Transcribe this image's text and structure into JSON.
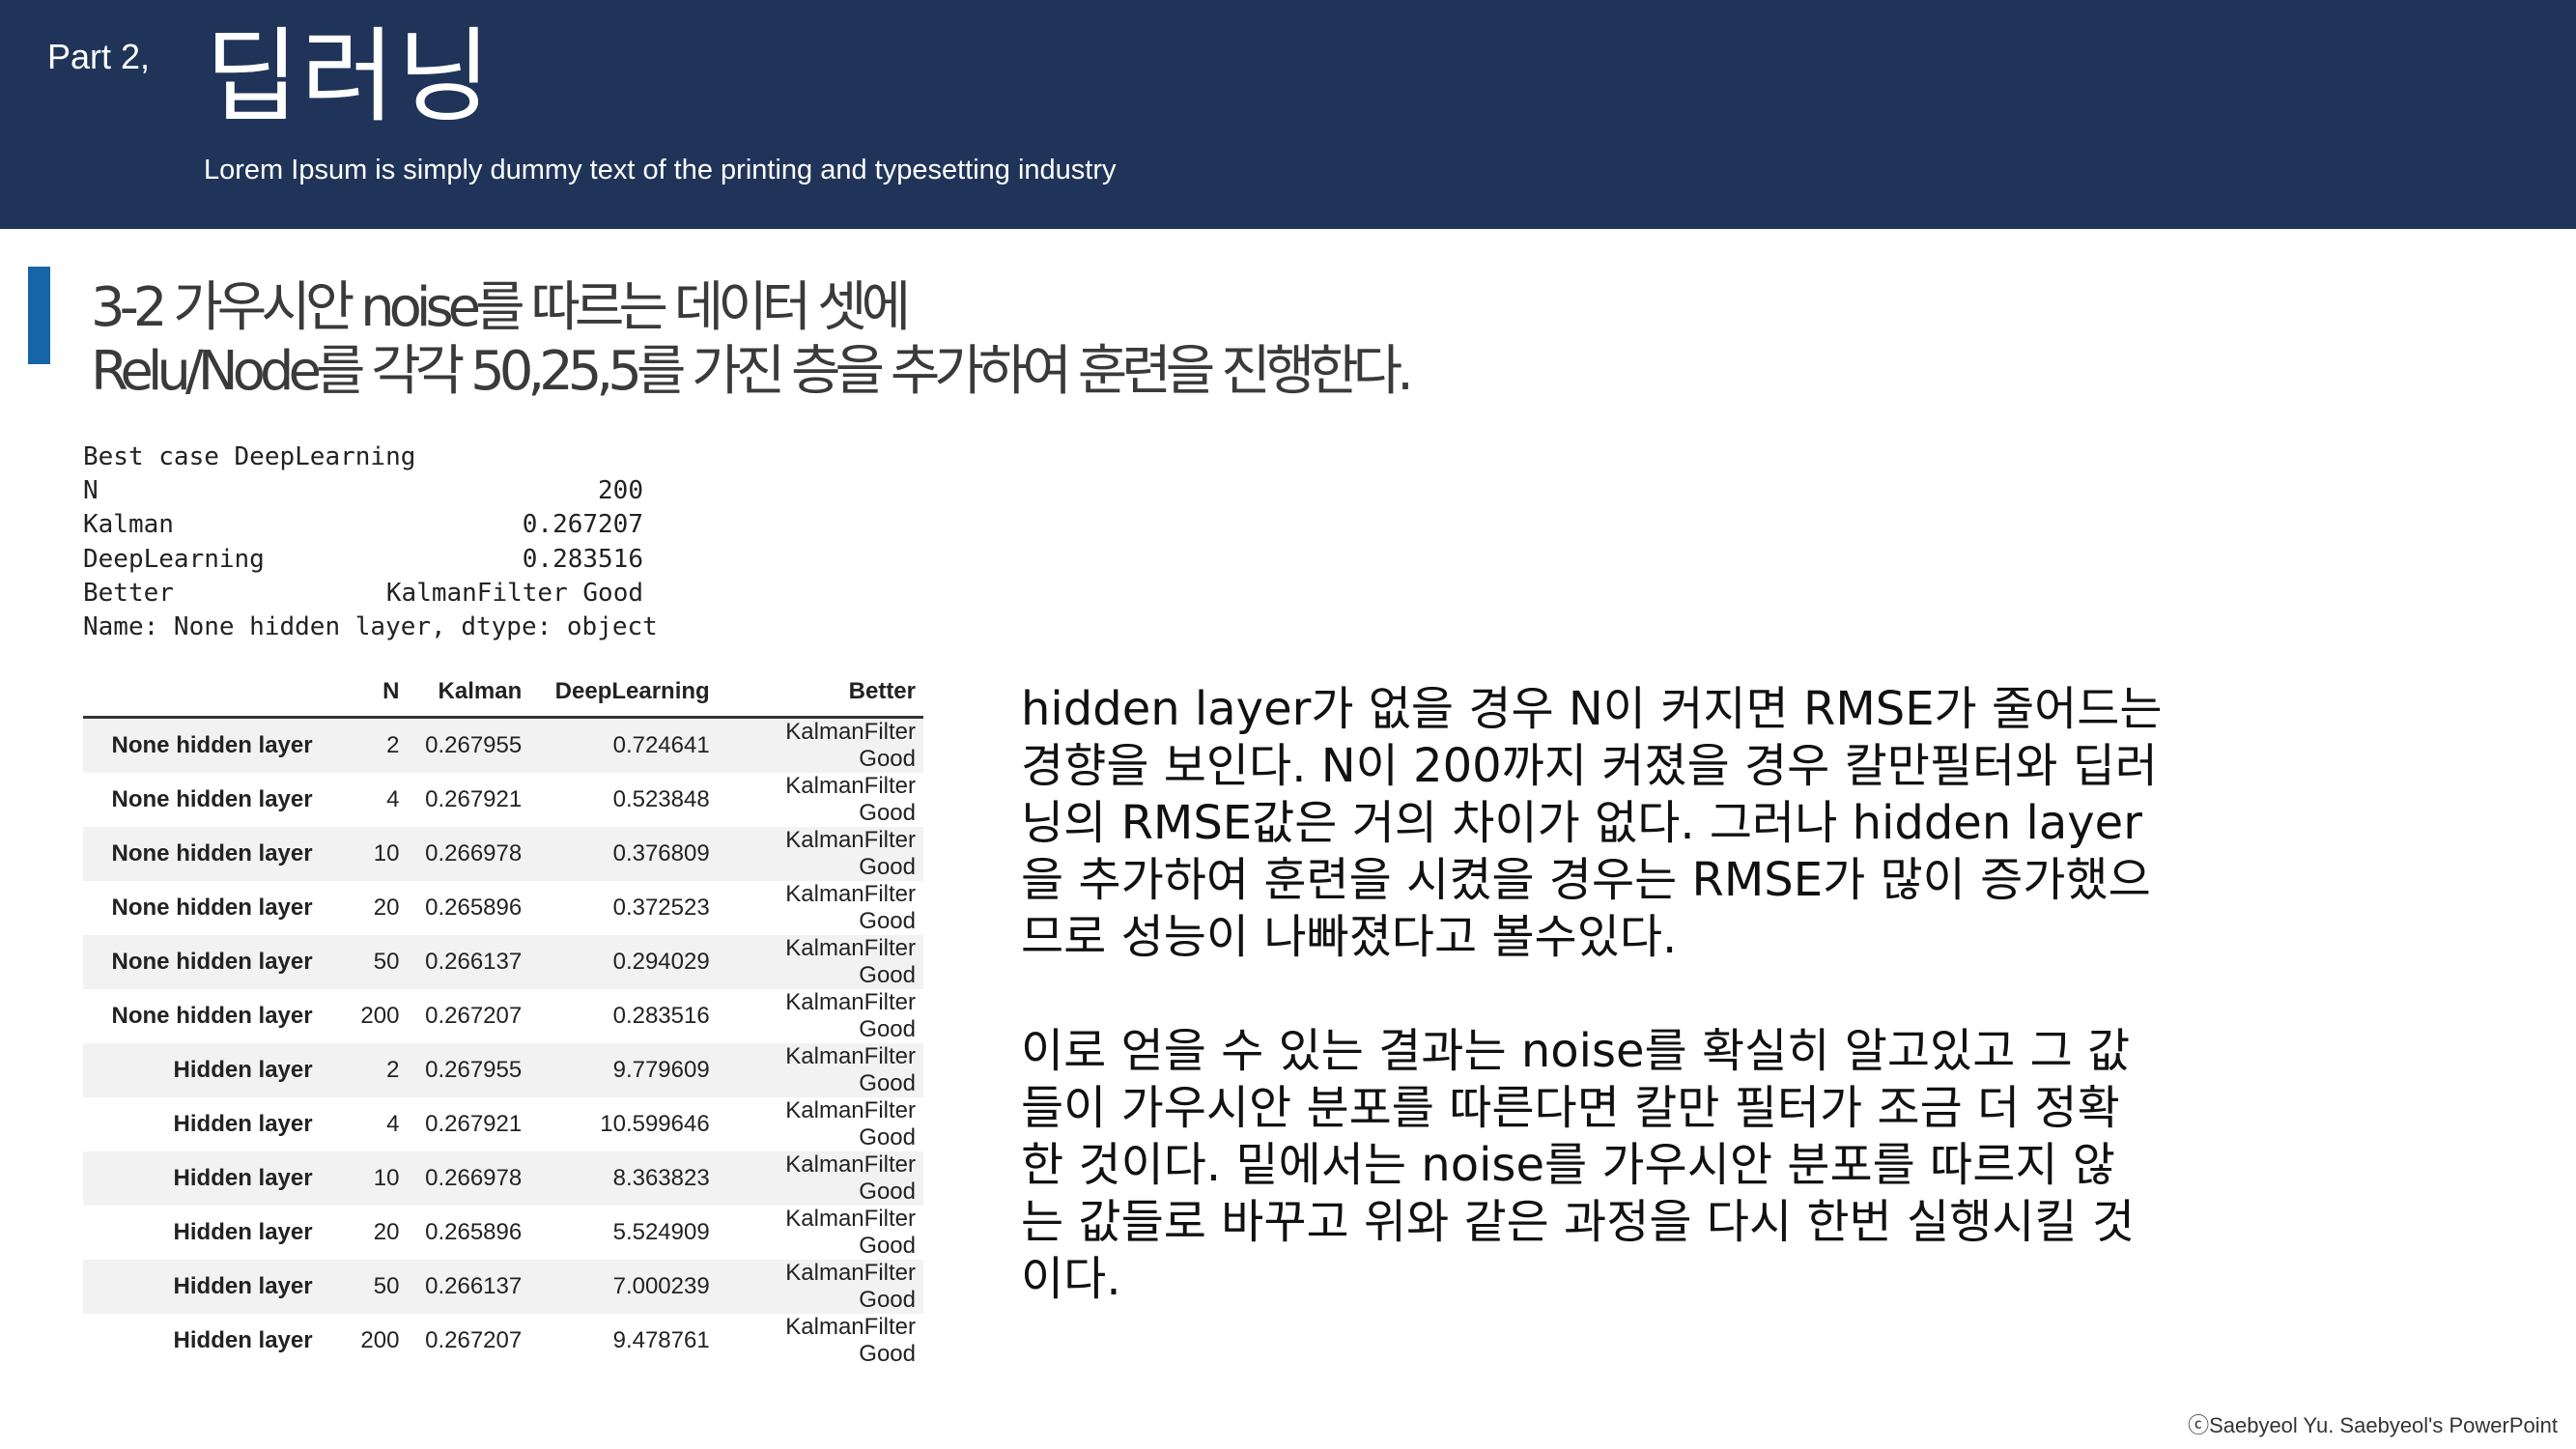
{
  "header": {
    "part_label": "Part 2,",
    "title": "딥러닝",
    "subtitle": "Lorem Ipsum is simply dummy text of the printing and typesetting industry",
    "background_color": "#1f3458"
  },
  "section": {
    "accent_color": "#1565a8",
    "heading_line1": "3-2 가우시안 noise를 따르는 데이터 셋에",
    "heading_line2": "Relu/Node를 각각 50,25,5를 가진 층을 추가하여 훈련을 진행한다."
  },
  "series_output": {
    "title": "Best case DeepLearning",
    "rows": [
      {
        "key": "N",
        "value": "200"
      },
      {
        "key": "Kalman",
        "value": "0.267207"
      },
      {
        "key": "DeepLearning",
        "value": "0.283516"
      },
      {
        "key": "Better",
        "value": "KalmanFilter Good"
      }
    ],
    "footer": "Name: None hidden layer, dtype: object"
  },
  "table": {
    "headers": [
      "",
      "N",
      "Kalman",
      "DeepLearning",
      "Better"
    ],
    "rows": [
      [
        "None hidden layer",
        "2",
        "0.267955",
        "0.724641",
        "KalmanFilter Good"
      ],
      [
        "None hidden layer",
        "4",
        "0.267921",
        "0.523848",
        "KalmanFilter Good"
      ],
      [
        "None hidden layer",
        "10",
        "0.266978",
        "0.376809",
        "KalmanFilter Good"
      ],
      [
        "None hidden layer",
        "20",
        "0.265896",
        "0.372523",
        "KalmanFilter Good"
      ],
      [
        "None hidden layer",
        "50",
        "0.266137",
        "0.294029",
        "KalmanFilter Good"
      ],
      [
        "None hidden layer",
        "200",
        "0.267207",
        "0.283516",
        "KalmanFilter Good"
      ],
      [
        "Hidden layer",
        "2",
        "0.267955",
        "9.779609",
        "KalmanFilter Good"
      ],
      [
        "Hidden layer",
        "4",
        "0.267921",
        "10.599646",
        "KalmanFilter Good"
      ],
      [
        "Hidden layer",
        "10",
        "0.266978",
        "8.363823",
        "KalmanFilter Good"
      ],
      [
        "Hidden layer",
        "20",
        "0.265896",
        "5.524909",
        "KalmanFilter Good"
      ],
      [
        "Hidden layer",
        "50",
        "0.266137",
        "7.000239",
        "KalmanFilter Good"
      ],
      [
        "Hidden layer",
        "200",
        "0.267207",
        "9.478761",
        "KalmanFilter Good"
      ]
    ]
  },
  "body": {
    "paragraph1_lines": [
      "hidden layer가 없을 경우 N이 커지면 RMSE가 줄어드는",
      "경향을 보인다. N이 200까지 커졌을 경우 칼만필터와 딥러",
      "닝의 RMSE값은 거의 차이가 없다. 그러나 hidden layer",
      "을 추가하여 훈련을 시켰을 경우는 RMSE가 많이 증가했으",
      "므로 성능이 나빠졌다고 볼수있다."
    ],
    "paragraph2_lines": [
      "이로 얻을 수 있는 결과는 noise를 확실히 알고있고 그 값",
      "들이 가우시안 분포를 따른다면 칼만 필터가 조금 더 정확",
      "한 것이다. 밑에서는 noise를 가우시안 분포를 따르지 않",
      "는 값들로 바꾸고 위와 같은 과정을 다시 한번 실행시킬 것",
      "이다."
    ]
  },
  "footer": {
    "copyright": "ⓒSaebyeol Yu. Saebyeol's PowerPoint"
  }
}
